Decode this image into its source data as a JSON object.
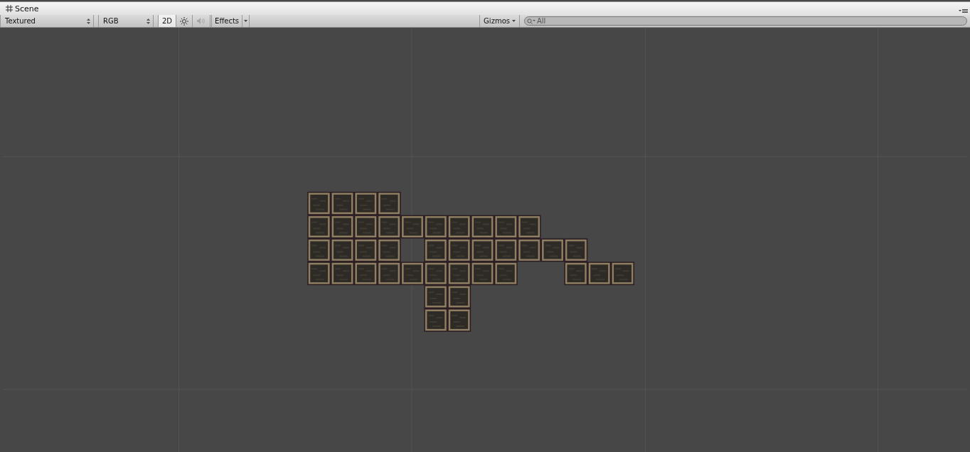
{
  "window": {
    "title": "Scene"
  },
  "toolbar": {
    "draw_mode": "Textured",
    "render_mode": "RGB",
    "toggles": [
      {
        "kind": "text",
        "label": "2D",
        "on": true
      },
      {
        "kind": "light",
        "on": false
      },
      {
        "kind": "audio",
        "on": false,
        "disabled": true
      }
    ],
    "effects": "Effects",
    "gizmos": "Gizmos",
    "search": {
      "placeholder": "All"
    }
  }
}
